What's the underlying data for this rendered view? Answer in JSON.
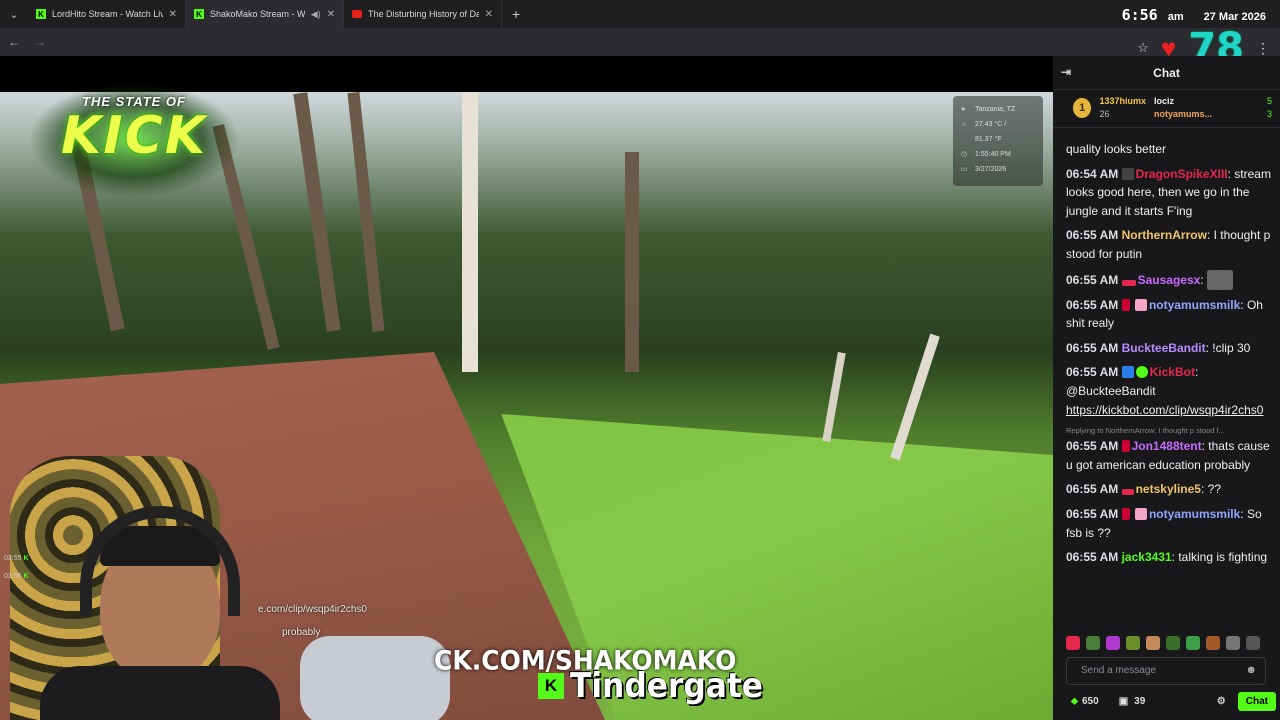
{
  "browser": {
    "tabs": [
      {
        "label": "LordHito Stream - Watch Live o",
        "icon": "kick-favicon"
      },
      {
        "label": "ShakoMako Stream - Watc",
        "icon": "kick-favicon",
        "active": true
      },
      {
        "label": "The Disturbing History of Dani",
        "icon": "youtube-favicon"
      }
    ],
    "time": "6:56",
    "ampm": "am",
    "date": "27 Mar 2026",
    "overlay_number": "78"
  },
  "overlay": {
    "logo_top": "THE STATE OF",
    "logo_main": "KICK",
    "weather": {
      "location": "Tanzania, TZ",
      "temp_c": "27.43 °C /",
      "temp_f": "81.37 °F",
      "time": "1:55:40 PM",
      "date": "3/27/2026"
    },
    "chat_link_fragment": "e.com/clip/wsqp4ir2chs0",
    "chat_probably": "probably",
    "mini_times": [
      "03:55",
      "03:55"
    ],
    "kick_url": "CK.COM/SHAKOMAKO",
    "subtitle_badge": "K",
    "subtitle_word": "Tindergate"
  },
  "chat": {
    "title": "Chat",
    "leaders": {
      "rank": "1",
      "first_name": "1337hiumx",
      "first_count": "26",
      "second_name": "lociz",
      "second_count": "5",
      "third_name": "notyamums...",
      "third_count": "3"
    },
    "messages": [
      {
        "time": "",
        "user": "",
        "text": "quality looks better"
      },
      {
        "time": "06:54 AM",
        "user": "DragonSpikeXIII",
        "color": "#e5264d",
        "text": "stream looks good here, then we go in the jungle and it starts F'ing"
      },
      {
        "time": "06:55 AM",
        "user": "NorthernArrow",
        "color": "#f0c468",
        "text": "I thought p stood for putin"
      },
      {
        "time": "06:55 AM",
        "user": "Sausagesx",
        "color": "#c86bff",
        "text": ""
      },
      {
        "time": "06:55 AM",
        "user": "notyamumsmilk",
        "color": "#8fa6ff",
        "text": "Oh shit realy"
      },
      {
        "time": "06:55 AM",
        "user": "BuckteeBandit",
        "color": "#b58cff",
        "text": "!clip 30"
      },
      {
        "time": "06:55 AM",
        "user": "KickBot",
        "color": "#e5264d",
        "text": "@BuckteeBandit",
        "link": "https://kickbot.com/clip/wsqp4ir2chs0"
      },
      {
        "time": "06:55 AM",
        "user": "Jon1488tent",
        "color": "#c86bff",
        "text": "thats cause u got american education probably",
        "reply": "Replying to NorthernArrow: I thought p stood f..."
      },
      {
        "time": "06:55 AM",
        "user": "netskyline5",
        "color": "#f0c468",
        "text": "??"
      },
      {
        "time": "06:55 AM",
        "user": "notyamumsmilk",
        "color": "#8fa6ff",
        "text": "So fsb is ??"
      },
      {
        "time": "06:55 AM",
        "user": "jack3431",
        "color": "#53fc18",
        "text": "talking is fighting"
      }
    ],
    "send_placeholder": "Send a message",
    "points": "650",
    "gifts": "39",
    "chat_button": "Chat"
  }
}
